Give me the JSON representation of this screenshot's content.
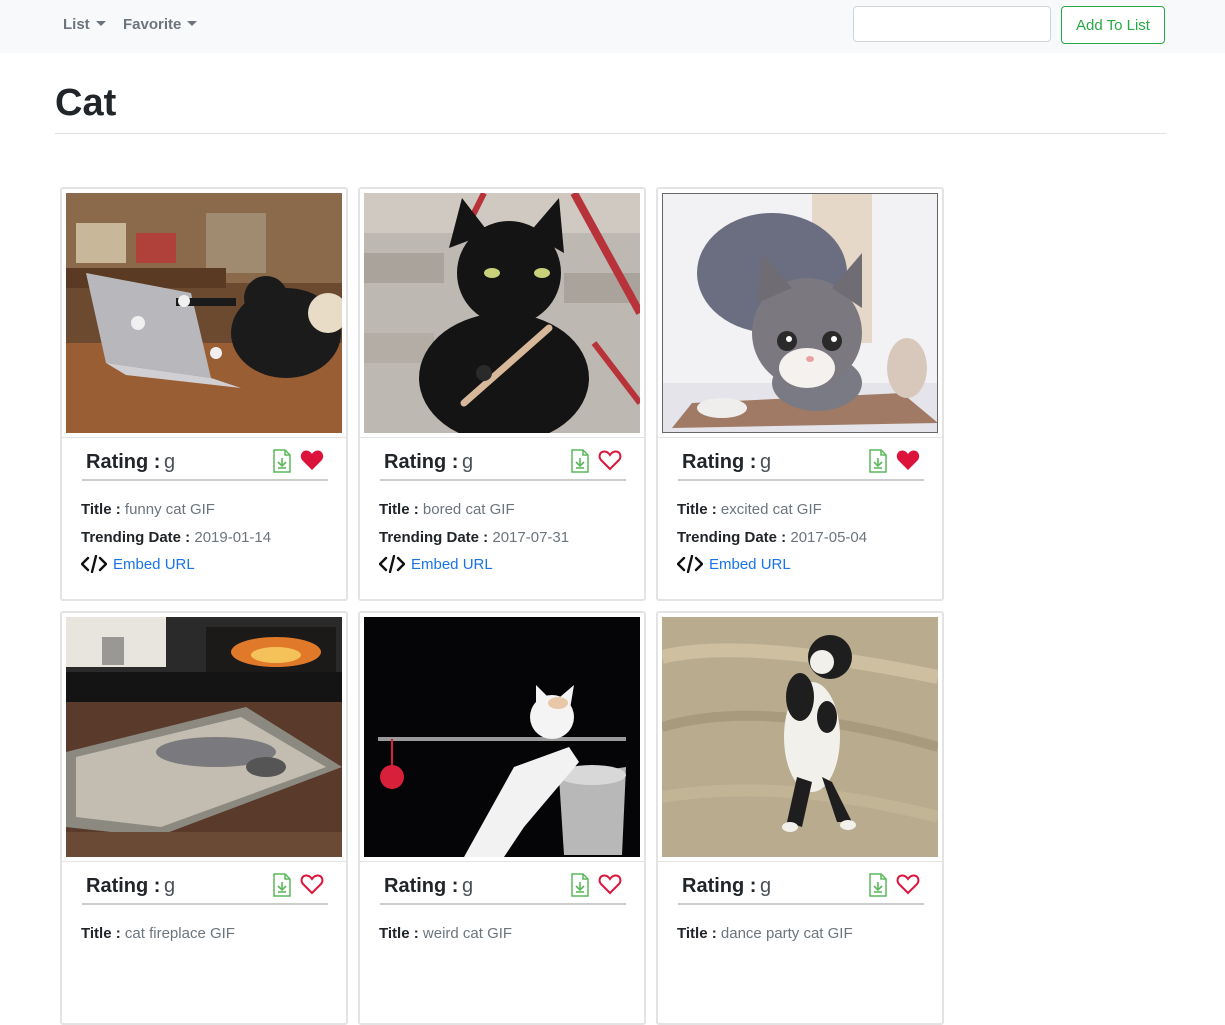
{
  "navbar": {
    "menus": [
      {
        "label": "List"
      },
      {
        "label": "Favorite"
      }
    ],
    "search": {
      "value": "",
      "placeholder": ""
    },
    "add_button_label": "Add To List"
  },
  "page": {
    "title": "Cat"
  },
  "labels": {
    "rating": "Rating :",
    "title": "Title :",
    "trending_date": "Trending Date :",
    "embed_url": "Embed URL"
  },
  "colors": {
    "accent_green": "#28a745",
    "heart_red": "#dc143c",
    "link_blue": "#1a73e8"
  },
  "cards": [
    {
      "rating": "g",
      "title": "funny cat GIF",
      "trending_date": "2019-01-14",
      "favorited": true
    },
    {
      "rating": "g",
      "title": "bored cat GIF",
      "trending_date": "2017-07-31",
      "favorited": false
    },
    {
      "rating": "g",
      "title": "excited cat GIF",
      "trending_date": "2017-05-04",
      "favorited": true
    },
    {
      "rating": "g",
      "title": "cat fireplace GIF",
      "trending_date": "",
      "favorited": false
    },
    {
      "rating": "g",
      "title": "weird cat GIF",
      "trending_date": "",
      "favorited": false
    },
    {
      "rating": "g",
      "title": "dance party cat GIF",
      "trending_date": "",
      "favorited": false
    }
  ]
}
